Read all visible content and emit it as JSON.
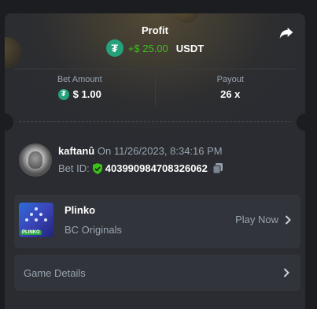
{
  "profit": {
    "title": "Profit",
    "amount": "+$ 25.00",
    "currency": "USDT",
    "currency_icon": "tether-icon",
    "amount_color": "#3bc117"
  },
  "stats": {
    "bet_amount_label": "Bet Amount",
    "bet_amount_value": "$ 1.00",
    "payout_label": "Payout",
    "payout_value": "26 x"
  },
  "bet": {
    "username": "kaftanû",
    "timestamp": "On 11/26/2023, 8:34:16 PM",
    "bet_id_label": "Bet ID:",
    "bet_id": "403990984708326062"
  },
  "game": {
    "name": "Plinko",
    "provider": "BC Originals",
    "play_label": "Play Now",
    "thumb_label": "PLINKO"
  },
  "details": {
    "label": "Game Details"
  },
  "colors": {
    "card_bg": "#2a2c31",
    "accent_green": "#3bc117",
    "tether": "#26a17b",
    "muted_text": "#99a4b0"
  }
}
